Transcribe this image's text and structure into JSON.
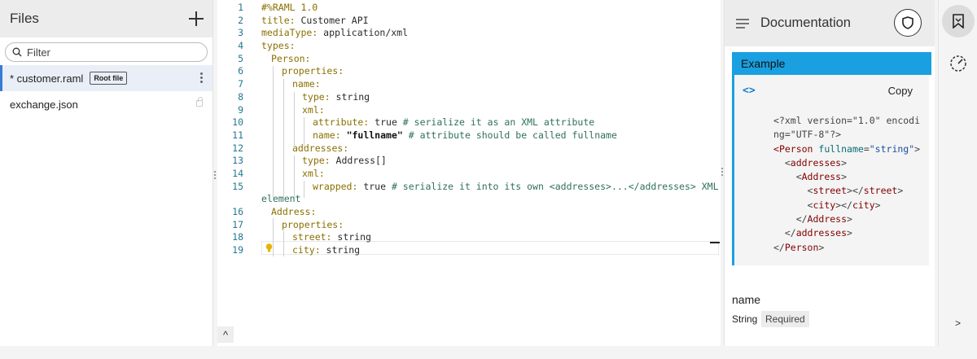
{
  "files": {
    "title": "Files",
    "filter_placeholder": "Filter",
    "items": [
      {
        "name": "* customer.raml",
        "badge": "Root file"
      },
      {
        "name": "exchange.json"
      }
    ]
  },
  "editor": {
    "lines": [
      {
        "n": "1"
      },
      {
        "n": "2"
      },
      {
        "n": "3"
      },
      {
        "n": "4"
      },
      {
        "n": "5"
      },
      {
        "n": "6"
      },
      {
        "n": "7"
      },
      {
        "n": "8"
      },
      {
        "n": "9"
      },
      {
        "n": "10"
      },
      {
        "n": "11"
      },
      {
        "n": "12"
      },
      {
        "n": "13"
      },
      {
        "n": "14"
      },
      {
        "n": "15"
      },
      {
        "n": "16"
      },
      {
        "n": "17"
      },
      {
        "n": "18"
      },
      {
        "n": "19"
      }
    ],
    "code": {
      "l1": "#%RAML 1.0",
      "l2k": "title:",
      "l2v": " Customer API",
      "l3k": "mediaType:",
      "l3v": " application/xml",
      "l4k": "types:",
      "l5k": "Person:",
      "l6k": "properties:",
      "l7k": "name:",
      "l8k": "type:",
      "l8v": " string",
      "l9k": "xml:",
      "l10k": "attribute:",
      "l10v": " true ",
      "l10c": "# serialize it as an XML attribute",
      "l11k": "name:",
      "l11s": "\"fullname\"",
      "l11c": " # attribute should be called fullname",
      "l12k": "addresses:",
      "l13k": "type:",
      "l13v": " Address[]",
      "l14k": "xml:",
      "l15k": "wrapped:",
      "l15v": " true ",
      "l15c": "# serialize it into its own <addresses>...</addresses> XML",
      "l15wrap": "element",
      "l16k": "Address:",
      "l17k": "properties:",
      "l18k": "street:",
      "l18v": " string",
      "l19k": "city:",
      "l19v": " string"
    },
    "collapse_label": "^"
  },
  "documentation": {
    "title": "Documentation",
    "example_title": "Example",
    "code_toggle": "<>",
    "copy_label": "Copy",
    "xml": {
      "decl1": "<?xml version=\"1.0\" encodi",
      "decl2": "ng=\"UTF-8\"?>",
      "person_open": "Person",
      "attr": "fullname",
      "attr_val": "\"string\"",
      "addresses": "addresses",
      "address": "Address",
      "street": "street",
      "city": "city",
      "person_close": "Person"
    },
    "property": {
      "name": "name",
      "type": "String",
      "required": "Required"
    }
  },
  "iconbar": {
    "expand_label": ">"
  }
}
